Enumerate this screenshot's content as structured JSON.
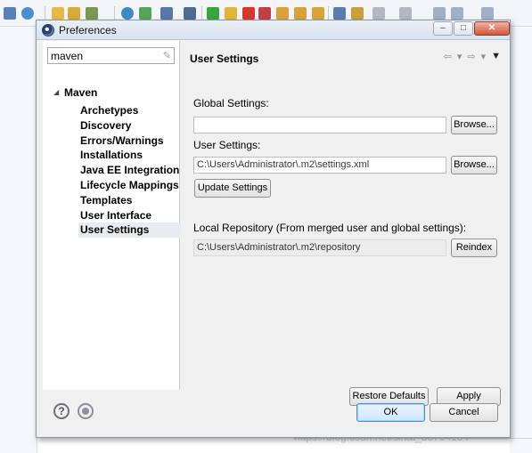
{
  "window": {
    "title": "Preferences"
  },
  "filter": {
    "value": "maven"
  },
  "tree": {
    "root": "Maven",
    "items": [
      "Archetypes",
      "Discovery",
      "Errors/Warnings",
      "Installations",
      "Java EE Integration",
      "Lifecycle Mappings",
      "Templates",
      "User Interface",
      "User Settings"
    ],
    "selected": "User Settings"
  },
  "page": {
    "title": "User Settings",
    "global_settings_label": "Global Settings:",
    "global_settings_value": "",
    "browse_label": "Browse...",
    "user_settings_label": "User Settings:",
    "user_settings_value": "C:\\Users\\Administrator\\.m2\\settings.xml",
    "update_label": "Update Settings",
    "local_repo_label": "Local Repository (From merged user and global settings):",
    "local_repo_value": "C:\\Users\\Administrator\\.m2\\repository",
    "reindex_label": "Reindex",
    "restore_label": "Restore Defaults",
    "apply_label": "Apply"
  },
  "footer": {
    "ok_label": "OK",
    "cancel_label": "Cancel"
  },
  "watermark": "https://blog.csdn.net/sinat_36704104",
  "colors": {
    "selection": "#e8ecf1",
    "ok_border": "#3d8ee0",
    "dialog_bg": "#f0f0f0"
  }
}
